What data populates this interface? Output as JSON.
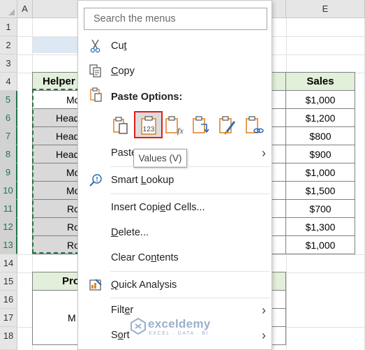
{
  "sheet": {
    "columns": {
      "a": "A",
      "e": "E"
    },
    "rows": [
      "1",
      "2",
      "3",
      "4",
      "5",
      "6",
      "7",
      "8",
      "9",
      "10",
      "11",
      "12",
      "13",
      "14",
      "15",
      "16",
      "17",
      "18"
    ],
    "header_left": "Helper",
    "header_right": "Sales",
    "left_cells": [
      "Mo",
      "Head",
      "Head",
      "Head",
      "Mo",
      "Mo",
      "Ro",
      "Ro",
      "Ro"
    ],
    "sales": [
      "$1,000",
      "$1,200",
      "$800",
      "$900",
      "$1,000",
      "$1,500",
      "$700",
      "$1,300",
      "$1,000"
    ],
    "lower_header": "Pro",
    "lower_cell": "M",
    "colors": {
      "header_fill": "#e2efda",
      "selected_fill": "#d9d9d9",
      "title_fill": "#dde8f5",
      "selection_border": "#217346"
    }
  },
  "menu": {
    "search_placeholder": "Search the menus",
    "cut": {
      "pre": "Cu",
      "key": "t",
      "post": ""
    },
    "copy": {
      "pre": "",
      "key": "C",
      "post": "opy"
    },
    "paste_options_label": "Paste Options:",
    "paste_icons": [
      "paste-icon",
      "paste-values-icon",
      "paste-formulas-icon",
      "paste-transpose-icon",
      "paste-formatting-icon",
      "paste-link-icon"
    ],
    "paste_values_badge": "123",
    "paste_formula_badge": "fx",
    "paste_special": {
      "pre": "Paste",
      "key": "",
      "post": ""
    },
    "tooltip": "Values (V)",
    "smart_lookup": {
      "pre": "Smart ",
      "key": "L",
      "post": "ookup"
    },
    "insert_copied": {
      "pre": "Insert Copi",
      "key": "e",
      "post": "d Cells..."
    },
    "delete": {
      "pre": "",
      "key": "D",
      "post": "elete..."
    },
    "clear_contents": {
      "pre": "Clear Co",
      "key": "n",
      "post": "tents"
    },
    "quick_analysis": {
      "pre": "",
      "key": "Q",
      "post": "uick Analysis"
    },
    "filter": {
      "pre": "Filt",
      "key": "e",
      "post": "r"
    },
    "sort": {
      "pre": "S",
      "key": "o",
      "post": "rt"
    },
    "chevron": "›",
    "colors": {
      "highlight": "#e21b1b",
      "icon_orange": "#e0862a",
      "icon_blue": "#2b6bb5"
    }
  },
  "watermark": {
    "brand": "exceldemy",
    "sub": "EXCEL · DATA · BI"
  }
}
